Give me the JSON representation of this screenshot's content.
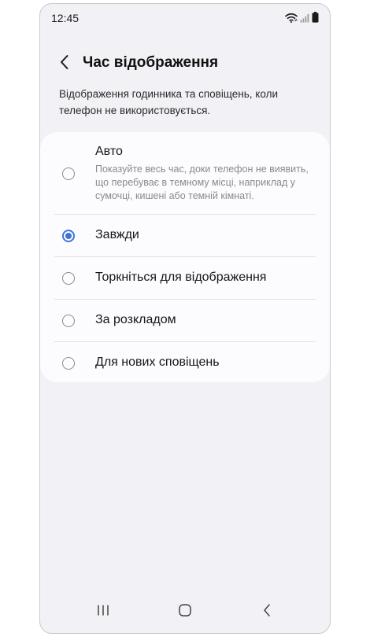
{
  "status_bar": {
    "time": "12:45",
    "icons": [
      "wifi-icon",
      "signal-icon",
      "battery-icon"
    ]
  },
  "header": {
    "title": "Час відображення",
    "back_icon": "chevron-left-icon"
  },
  "description": "Відображення годинника та сповіщень, коли телефон не використовується.",
  "options": [
    {
      "label": "Авто",
      "sublabel": "Показуйте весь час, доки телефон не виявить, що перебуває в темному місці, наприклад у сумочці, кишені або темній кімнаті.",
      "selected": false
    },
    {
      "label": "Завжди",
      "selected": true
    },
    {
      "label": "Торкніться для відображення",
      "selected": false
    },
    {
      "label": "За розкладом",
      "selected": false
    },
    {
      "label": "Для нових сповіщень",
      "selected": false
    }
  ],
  "nav_bar": {
    "icons": [
      "recents-icon",
      "home-icon",
      "back-icon"
    ]
  },
  "colors": {
    "accent": "#3e74d8",
    "screen_background": "#f2f2f6",
    "card_background": "#fcfcfe",
    "secondary_text": "#8a8a8e"
  }
}
